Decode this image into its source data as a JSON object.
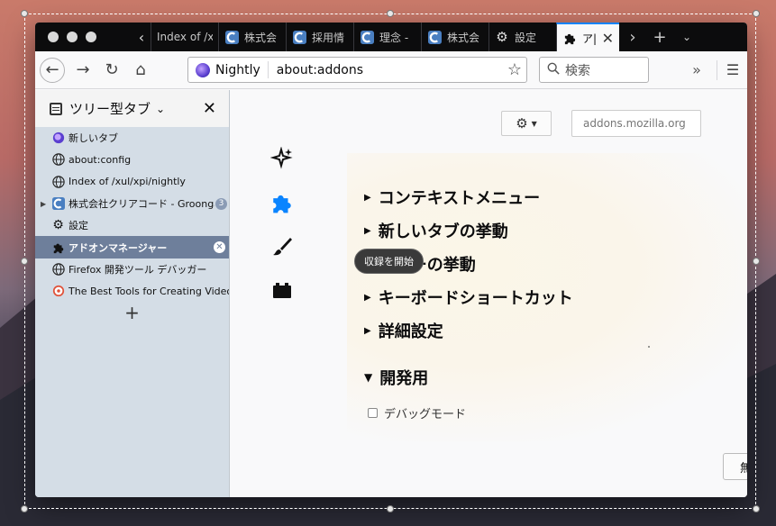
{
  "tabs": [
    {
      "title": "Index of /x",
      "icon": "globe-icon"
    },
    {
      "title": "株式会",
      "icon": "groonga-icon"
    },
    {
      "title": "採用情",
      "icon": "groonga-icon"
    },
    {
      "title": "理念 -",
      "icon": "groonga-icon"
    },
    {
      "title": "株式会",
      "icon": "groonga-icon"
    },
    {
      "title": "設定",
      "icon": "gear-icon"
    },
    {
      "title": "ア|",
      "icon": "puzzle-icon",
      "active": true
    }
  ],
  "navbar": {
    "identity_label": "Nightly",
    "url": "about:addons",
    "search_placeholder": "検索"
  },
  "sidebar": {
    "title": "ツリー型タブ",
    "items": [
      {
        "label": "新しいタブ",
        "icon": "nightly-icon"
      },
      {
        "label": "about:config",
        "icon": "globe-icon"
      },
      {
        "label": "Index of /xul/xpi/nightly",
        "icon": "globe-icon"
      },
      {
        "label": "株式会社クリアコード - Groonga",
        "icon": "groonga-icon",
        "count": "3",
        "collapsed": true
      },
      {
        "label": "設定",
        "icon": "gear-icon"
      },
      {
        "label": "アドオンマネージャー",
        "icon": "puzzle-icon",
        "active": true
      },
      {
        "label": "Firefox 開発ツール デバッガー",
        "icon": "globe-icon"
      },
      {
        "label": "The Best Tools for Creating Video",
        "icon": "video-tool-icon"
      }
    ]
  },
  "content": {
    "amo_search_placeholder": "addons.mozilla.org",
    "sections": [
      {
        "label": "コンテキストメニュー"
      },
      {
        "label": "新しいタブの挙動"
      },
      {
        "label": "ツリーの挙動"
      },
      {
        "label": "キーボードショートカット"
      },
      {
        "label": "詳細設定"
      },
      {
        "label": "開発用"
      }
    ],
    "debug_checkbox_label": "デバッグモード",
    "right_button_label": "無効"
  },
  "tooltip": {
    "label": "収録を開始"
  },
  "colors": {
    "accent": "#0a84ff",
    "sidebar_bg": "#d4dde6",
    "active_row": "#6e7f9b",
    "tab_strip": "#0c0c0d"
  }
}
